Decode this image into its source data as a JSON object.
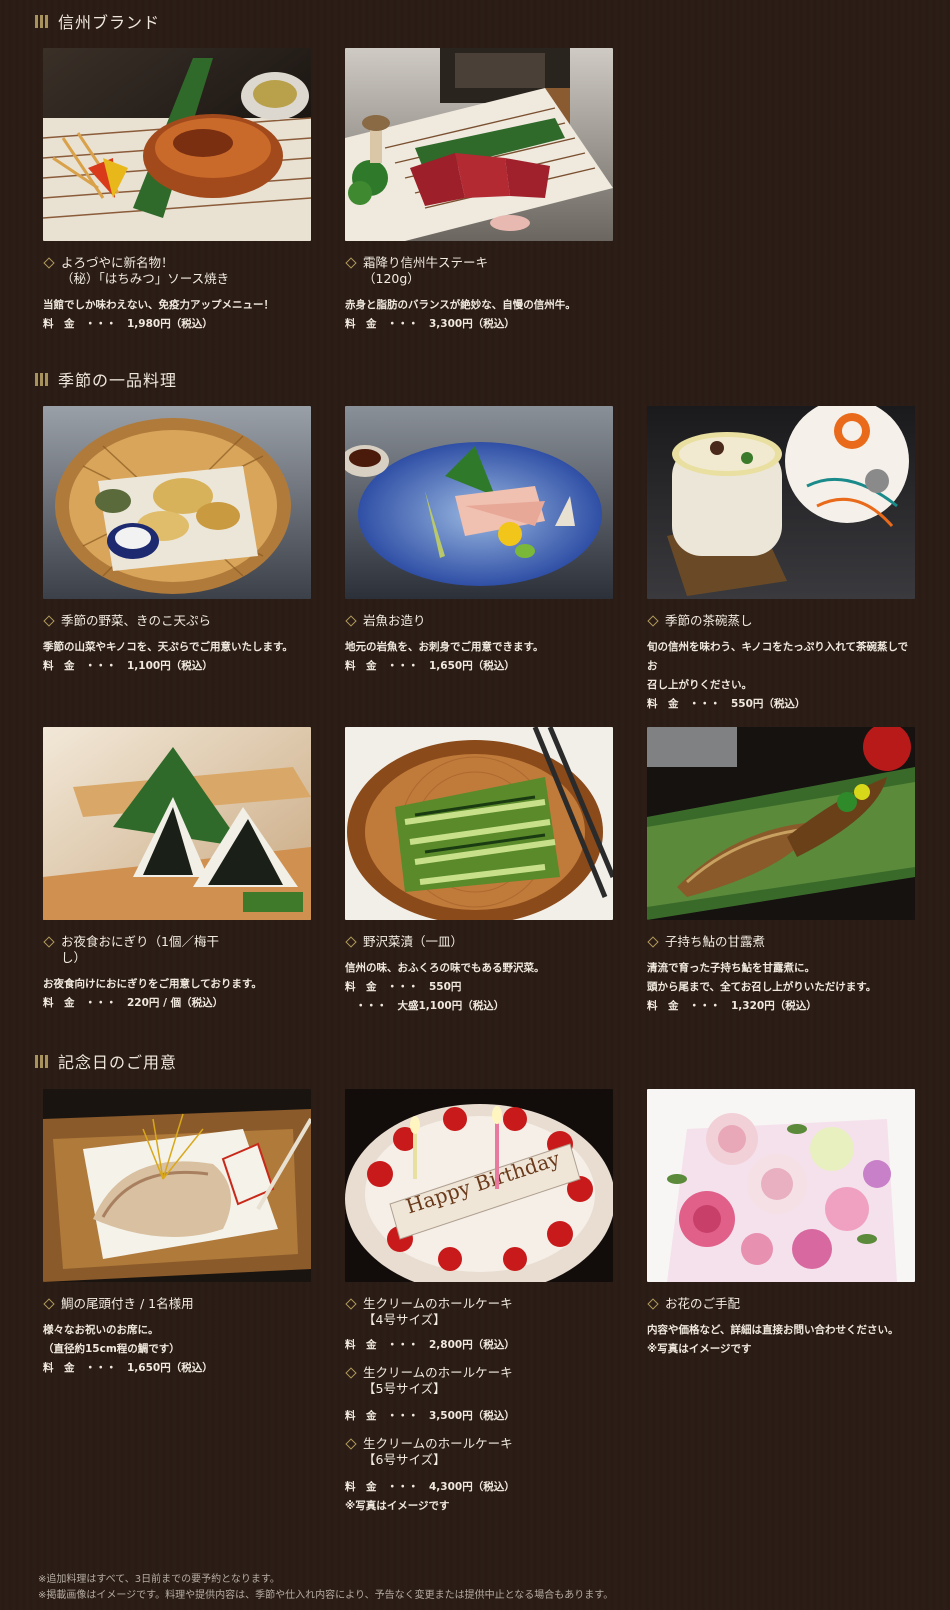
{
  "sections": {
    "shinshu": {
      "title": "信州ブランド"
    },
    "seasonal": {
      "title": "季節の一品料理"
    },
    "anniversary": {
      "title": "記念日のご用意"
    }
  },
  "cards": {
    "chicken": {
      "title": "よろづやに新名物！\n（秘）「はちみつ」ソース焼き",
      "desc": "当館でしか味わえない、免疫力アップメニュー！",
      "price": "料　金　・・・　1,980円（税込）"
    },
    "steak": {
      "title": "霜降り信州牛ステーキ\n（120g）",
      "desc": "赤身と脂肪のバランスが絶妙な、自慢の信州牛。",
      "price": "料　金　・・・　3,300円（税込）"
    },
    "tempura": {
      "title": "季節の野菜、きのこ天ぷら",
      "desc": "季節の山菜やキノコを、天ぷらでご用意いたします。",
      "price": "料　金　・・・　1,100円（税込）"
    },
    "sashimi": {
      "title": "岩魚お造り",
      "desc": "地元の岩魚を、お刺身でご用意できます。",
      "price": "料　金　・・・　1,650円（税込）"
    },
    "chawanmushi": {
      "title": "季節の茶碗蒸し",
      "desc": "旬の信州を味わう、キノコをたっぷり入れて茶碗蒸しでお\n召し上がりください。",
      "price": "料　金　・・・　550円（税込）"
    },
    "onigiri": {
      "title": "お夜食おにぎり（1個／梅干\nし）",
      "desc": "お夜食向けにおにぎりをご用意しております。",
      "price": "料　金　・・・　220円 / 個（税込）"
    },
    "nozawana": {
      "title": "野沢菜漬（一皿）",
      "desc": "信州の味、おふくろの味でもある野沢菜。",
      "price": "料　金　・・・　550円\n　・・・　大盛1,100円（税込）"
    },
    "ayu": {
      "title": "子持ち鮎の甘露煮",
      "desc": "清流で育った子持ち鮎を甘露煮に。\n頭から尾まで、全てお召し上がりいただけます。",
      "price": "料　金　・・・　1,320円（税込）"
    },
    "tai": {
      "title": "鯛の尾頭付き / 1名様用",
      "desc": "様々なお祝いのお席に。\n（直径約15cm程の鯛です）",
      "price": "料　金　・・・　1,650円（税込）"
    },
    "cake": {
      "items": [
        {
          "title": "生クリームのホールケーキ\n【4号サイズ】",
          "price": "料　金　・・・　2,800円（税込）"
        },
        {
          "title": "生クリームのホールケーキ\n【5号サイズ】",
          "price": "料　金　・・・　3,500円（税込）"
        },
        {
          "title": "生クリームのホールケーキ\n【6号サイズ】",
          "price": "料　金　・・・　4,300円（税込）"
        }
      ],
      "note": "※写真はイメージです",
      "photo_text": "Happy Birthday"
    },
    "flowers": {
      "title": "お花のご手配",
      "desc": "内容や価格など、詳細は直接お問い合わせください。\n※写真はイメージです"
    }
  },
  "footer": {
    "line1": "※追加料理はすべて、3日前までの要予約となります。",
    "line2": "※掲載画像はイメージです。料理や提供内容は、季節や仕入れ内容により、予告なく変更または提供中止となる場合もあります。"
  },
  "colors": {
    "background": "#2a1c15",
    "accent": "#b29a5c",
    "text": "#f0e8dd"
  }
}
